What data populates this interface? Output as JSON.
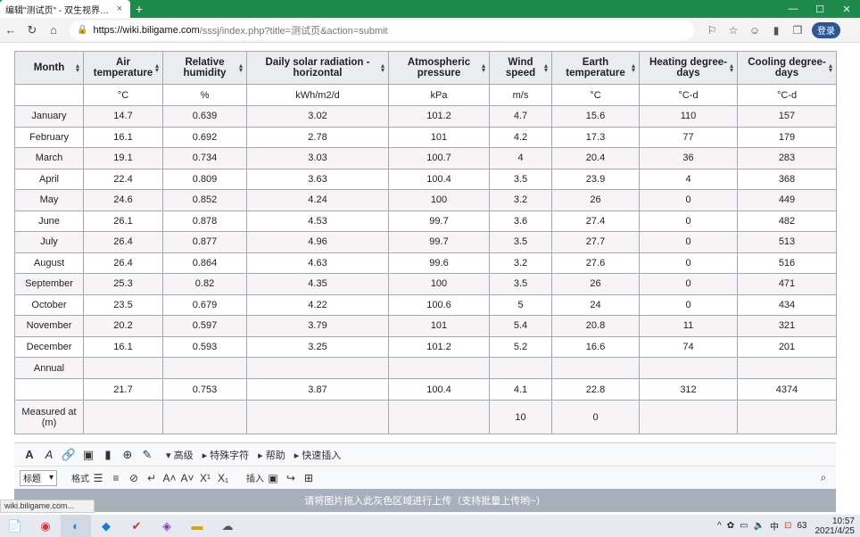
{
  "browser": {
    "tab_title": "编辑\"测试页\" - 双生视界WIKI_BW",
    "tab_close": "×",
    "new_tab": "+",
    "url_host": "https://wiki.biligame.com",
    "url_rest": "/sssj/index.php?title=测试页&action=submit",
    "login_label": "登录"
  },
  "table": {
    "headers": [
      {
        "label": "Month"
      },
      {
        "label": "Air temperature"
      },
      {
        "label": "Relative humidity"
      },
      {
        "label": "Daily solar radiation - horizontal"
      },
      {
        "label": "Atmospheric pressure"
      },
      {
        "label": "Wind speed"
      },
      {
        "label": "Earth temperature"
      },
      {
        "label": "Heating degree-days"
      },
      {
        "label": "Cooling degree-days"
      }
    ],
    "units": [
      "",
      "°C",
      "%",
      "kWh/m2/d",
      "kPa",
      "m/s",
      "°C",
      "°C-d",
      "°C-d"
    ],
    "rows": [
      {
        "month": "January",
        "air": "14.7",
        "rh": "0.639",
        "solar": "3.02",
        "pressure": "101.2",
        "wind": "4.7",
        "earth": "15.6",
        "heating": "110",
        "cooling": "157"
      },
      {
        "month": "February",
        "air": "16.1",
        "rh": "0.692",
        "solar": "2.78",
        "pressure": "101",
        "wind": "4.2",
        "earth": "17.3",
        "heating": "77",
        "cooling": "179"
      },
      {
        "month": "March",
        "air": "19.1",
        "rh": "0.734",
        "solar": "3.03",
        "pressure": "100.7",
        "wind": "4",
        "earth": "20.4",
        "heating": "36",
        "cooling": "283"
      },
      {
        "month": "April",
        "air": "22.4",
        "rh": "0.809",
        "solar": "3.63",
        "pressure": "100.4",
        "wind": "3.5",
        "earth": "23.9",
        "heating": "4",
        "cooling": "368"
      },
      {
        "month": "May",
        "air": "24.6",
        "rh": "0.852",
        "solar": "4.24",
        "pressure": "100",
        "wind": "3.2",
        "earth": "26",
        "heating": "0",
        "cooling": "449"
      },
      {
        "month": "June",
        "air": "26.1",
        "rh": "0.878",
        "solar": "4.53",
        "pressure": "99.7",
        "wind": "3.6",
        "earth": "27.4",
        "heating": "0",
        "cooling": "482"
      },
      {
        "month": "July",
        "air": "26.4",
        "rh": "0.877",
        "solar": "4.96",
        "pressure": "99.7",
        "wind": "3.5",
        "earth": "27.7",
        "heating": "0",
        "cooling": "513"
      },
      {
        "month": "August",
        "air": "26.4",
        "rh": "0.864",
        "solar": "4.63",
        "pressure": "99.6",
        "wind": "3.2",
        "earth": "27.6",
        "heating": "0",
        "cooling": "516"
      },
      {
        "month": "September",
        "air": "25.3",
        "rh": "0.82",
        "solar": "4.35",
        "pressure": "100",
        "wind": "3.5",
        "earth": "26",
        "heating": "0",
        "cooling": "471"
      },
      {
        "month": "October",
        "air": "23.5",
        "rh": "0.679",
        "solar": "4.22",
        "pressure": "100.6",
        "wind": "5",
        "earth": "24",
        "heating": "0",
        "cooling": "434"
      },
      {
        "month": "November",
        "air": "20.2",
        "rh": "0.597",
        "solar": "3.79",
        "pressure": "101",
        "wind": "5.4",
        "earth": "20.8",
        "heating": "11",
        "cooling": "321"
      },
      {
        "month": "December",
        "air": "16.1",
        "rh": "0.593",
        "solar": "3.25",
        "pressure": "101.2",
        "wind": "5.2",
        "earth": "16.6",
        "heating": "74",
        "cooling": "201"
      }
    ],
    "annual_label": "Annual",
    "summary": {
      "month": "",
      "air": "21.7",
      "rh": "0.753",
      "solar": "3.87",
      "pressure": "100.4",
      "wind": "4.1",
      "earth": "22.8",
      "heating": "312",
      "cooling": "4374"
    },
    "measured": {
      "label": "Measured at (m)",
      "wind": "10",
      "earth": "0"
    }
  },
  "editor": {
    "advanced": "高级",
    "special_chars": "特殊字符",
    "help": "帮助",
    "quick_insert": "快速插入",
    "heading_select": "标题",
    "format_label": "格式",
    "insert_label": "插入",
    "dropzone_text": "请将图片拖入此灰色区域进行上传（支持批量上传哟~）"
  },
  "status_url": "wiki.biligame.com...",
  "taskbar": {
    "tray_lang": "中",
    "tray_badge": "63",
    "time": "10:57",
    "date": "2021/4/25"
  },
  "colors": {
    "tab_strip": "#1e8a4c",
    "header_bg": "#eaecf0",
    "alt_row": "#f8f4f6",
    "dropzone": "#a7b0bb"
  }
}
